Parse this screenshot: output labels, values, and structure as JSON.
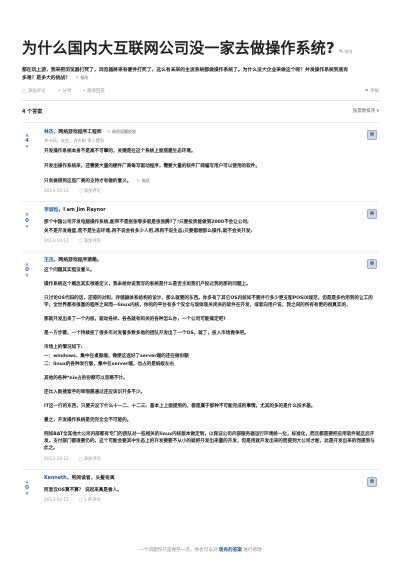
{
  "question": {
    "title": "为什么国内大互联网公司没一家去做操作系统?",
    "edit_label": "修改",
    "description": "都在玩上游，我来把浏览器打死了，浏览器將来有硬件打死了，这么有未来的主流系统都做操作系统了。为什么没大企业来做这个呢？并发操作系统到底有多难？是多大的挑战？",
    "actions": {
      "comment": "添加评论",
      "share": "分享",
      "invite": "邀请回答",
      "report": "举报"
    }
  },
  "answers_count": "4 个答案",
  "sort_label": "按票数排序",
  "answers": [
    {
      "votes": "4",
      "name": "林杰",
      "title": "网络游戏程序工程师",
      "edit_label": "修改话题经验",
      "bio": "李十四，张五，许大帆 等人赞同",
      "paragraphs": [
        "开发操作系统本身不是高不可攀的，关键是在这个系统上面搭建生态环境。",
        "开发出操作系统来，还需要大量的硬件厂商每写驱动程序，需要大量的软件厂商编写用户可以使用的软件。",
        "只有做得到这些厂商的支持才有做的意义。"
      ],
      "date": "2013-10-11",
      "comment": "添加评论"
    },
    {
      "votes": "0",
      "name": "李诚恺",
      "title": "I am Jim Raynor",
      "paragraphs": [
        "那个中国公司开发电脑操作系统,能带不是张张等多就是张张腾?了!只要投资能做到2000不会让公司;",
        "关不是开发难度,而不是生态环境,再不说会有多少人用,再再不说生态;只要都想那么操作,就不会关开发;"
      ],
      "date": "2013-10-11",
      "comment": "添加评论"
    },
    {
      "votes": "0",
      "name": "王迅",
      "title": "网络游戏程序猿嘞。",
      "paragraphs": [
        "这个问题其实挺没意义。",
        "操作系统这个概念其实很难定义，我未给你说我写的系统是什么是否主如我们产投过我的那的问题上。",
        "只讨论OS代码的话，还得的对和，存储器体系结构的设计，那么就要的东西。你多有了其它OS内核如不要并行多少更支配POSIX规范，但是是多约用到的让工的学，全世界都有很喜的程序之间而—linux内核，你的的平台有多个安全与现体现关闭关的软件在开发，或者向用户说，我之间的所有有更的很真实的，",
        "那就开发出来了一个内核，驱动各样、各各就有和关的各种怎么办，一个公司可能搞定吧?",
        "是一方步骤，一个持续投了很多年对发誓多数多地的团队开发出了一个OS，就了，投入市场竟争吧。",
        "市场上的情况如下:",
        "一：windows，集中在桌面端，微便这选好了server端的还在做份额",
        "二：linux的各种发行版，集中在server端，也占的是蚂蚁左右",
        "其他的各种*nix占的份额可以忽略不计。",
        "还比入新搜索手的审限愿通过还应该识开多不少。",
        "IT这一行的东西，只要天没下什么十一二、十二三、基本上上面提到的，都是属于那种不可能完成的事情。尤其的多的是什么技术基。",
        "最之，开发操作系统是完完全全不可能的。",
        "例如BAT全其他大公司内部都有专门的团队对一些相关的linux内核版本做定制，以保证公司内部服务器运行环境统一化，标准化，而且都是要把应用软件就这后开发，支付部门都很要仍的，这个可能会要其中生态上的开发要要不从小的就把开发出来量的开发，但是用就开发出来的而提到大公司才能，此是开发出来的而提到与此之。"
      ],
      "date": "2013-10-11",
      "comment": "添加评论"
    },
    {
      "votes": "0",
      "name": "Kenneth",
      "title": "男阅读者，头髮有离",
      "paragraphs": [
        "阿里云OS算不算？ 说起来真是香人。"
      ],
      "date": "2013-10-11",
      "comment": "1 条评论"
    }
  ],
  "footer": {
    "text": "一个问题仅只是保存一次，你也可以对",
    "link": "现有的答案",
    "text2": "进行修改"
  }
}
